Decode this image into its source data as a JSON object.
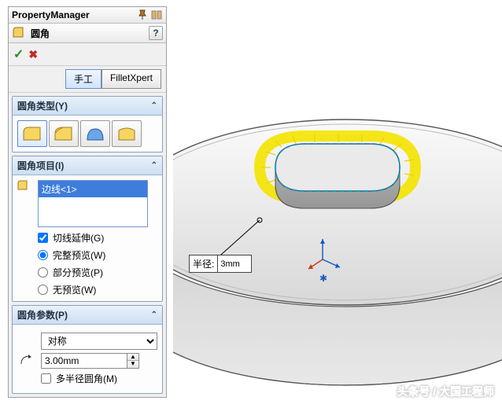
{
  "header": {
    "title": "PropertyManager"
  },
  "feature": {
    "name": "圆角",
    "help": "?"
  },
  "actions": {
    "ok": "✓",
    "cancel": "✖"
  },
  "tabs": {
    "manual": "手工",
    "xpert": "FilletXpert"
  },
  "sections": {
    "type": {
      "title": "圆角类型(Y)"
    },
    "items": {
      "title": "圆角项目(I)",
      "selected_edge": "边线<1>",
      "tangent": "切线延伸(G)",
      "full_preview": "完整预览(W)",
      "partial_preview": "部分预览(P)",
      "no_preview": "无预览(W)"
    },
    "params": {
      "title": "圆角参数(P)",
      "symmetry": "对称",
      "radius_value": "3.00mm",
      "multi_radius": "多半径圆角(M)"
    }
  },
  "callout": {
    "label": "半径:",
    "value": "3mm"
  },
  "watermark": "头条号 / 大国工程师"
}
